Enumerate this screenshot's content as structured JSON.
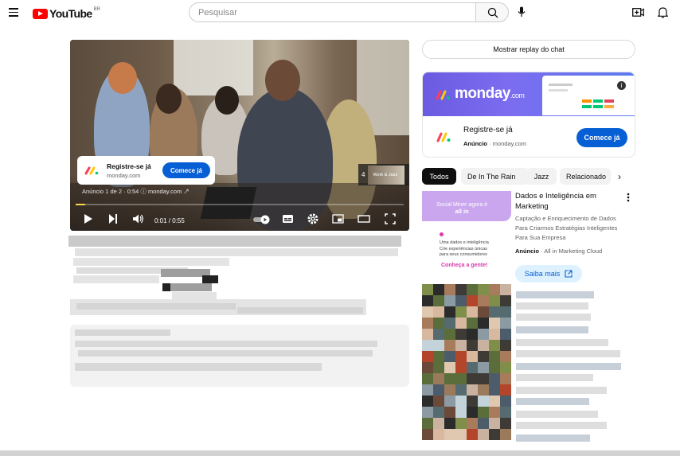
{
  "header": {
    "logo_text": "YouTube",
    "logo_region": "BR",
    "search_placeholder": "Pesquisar",
    "icons": [
      "menu-icon",
      "search-icon",
      "mic-icon",
      "create-icon",
      "bell-icon"
    ]
  },
  "player": {
    "ad_card": {
      "title": "Registre-se já",
      "domain": "monday.com",
      "cta": "Comece já"
    },
    "ad_info": "Anúncio 1 de 2 · 0:54 ⓘ  monday.com ↗",
    "next_ad_count": "4",
    "next_ad_thumb_text": "Work & Jazz",
    "time": "0:01 / 0:55",
    "progress": 0.03,
    "progress_color": "#f8d64e"
  },
  "sidebar": {
    "chat_replay": "Mostrar replay do chat",
    "sponsor": {
      "brand": "monday",
      "brand_suffix": ".com",
      "title": "Registre-se já",
      "ad_label": "Anúncio",
      "domain": "monday.com",
      "cta": "Comece já"
    },
    "chips": [
      "Todos",
      "De In The Rain",
      "Jazz",
      "Relacionado"
    ],
    "ad_video": {
      "thumb_line1": "Social Miner agora é",
      "thumb_line2": "all in",
      "thumb_body1": "Uma dados e inteligência",
      "thumb_body2": "Crie experiências únicas",
      "thumb_body3": "para seus consumidores",
      "thumb_link": "Conheça a gente!",
      "title": "Dados e Inteligência em Marketing",
      "description": "Captação e Enriquecimento de Dados Para Criarmos Estratégias Inteligentes Para Sua Empresa",
      "ad_label": "Anúncio",
      "advertiser": "All in Marketing Cloud",
      "cta": "Saiba mais"
    }
  },
  "colors": {
    "brand_red": "#ff0000",
    "cta_blue": "#065fd4",
    "monday_purple": "#6a5be0"
  }
}
